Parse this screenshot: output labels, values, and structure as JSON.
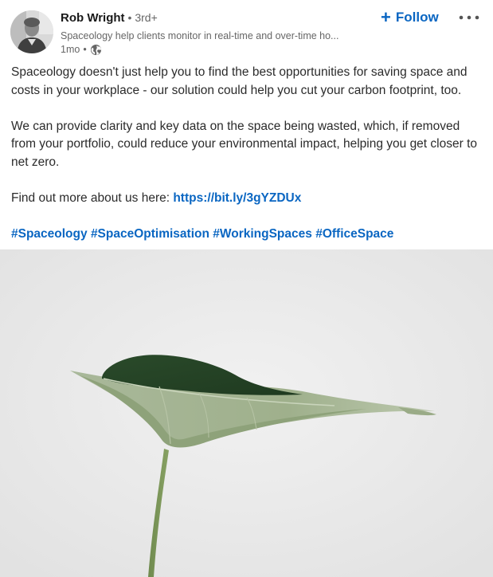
{
  "author": {
    "name": "Rob Wright",
    "degree": "• 3rd+",
    "headline": "Spaceology help clients monitor in real-time and over-time ho...",
    "time": "1mo",
    "visibility_icon": "globe-icon"
  },
  "actions": {
    "follow_label": "Follow",
    "follow_icon": "plus-icon",
    "more_icon": "more-options-icon"
  },
  "post": {
    "paragraph_1": "Spaceology doesn't just help you to find the best opportunities for saving space and costs in your workplace - our solution could help you cut your carbon footprint, too.",
    "paragraph_2": "We can provide clarity and key data on the space being wasted, which, if removed from your portfolio, could reduce your environmental impact, helping you get closer to net zero.",
    "find_out_text": "Find out more about us here: ",
    "link_text": "https://bit.ly/3gYZDUx",
    "hashtags": [
      "#Spaceology",
      "#SpaceOptimisation",
      "#WorkingSpaces",
      "#OfficeSpace"
    ]
  },
  "image": {
    "subject": "plant-leaf-image"
  },
  "colors": {
    "accent": "#0a66c2",
    "text_secondary": "#666666",
    "image_background": "#ebebeb",
    "leaf": "#2f4a2c"
  }
}
